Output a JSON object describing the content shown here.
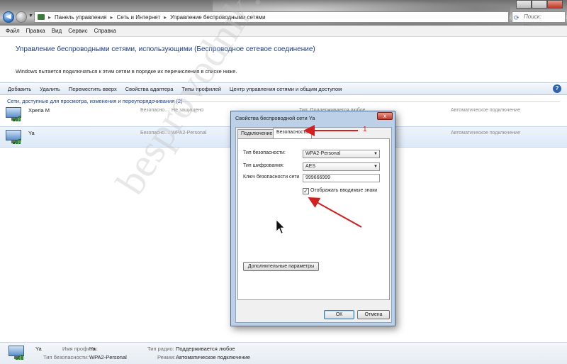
{
  "address_bar": {
    "crumbs": [
      "Панель управления",
      "Сеть и Интернет",
      "Управление беспроводными сетями"
    ],
    "search_placeholder": "Поиск: Управлен..."
  },
  "menu": [
    "Файл",
    "Правка",
    "Вид",
    "Сервис",
    "Справка"
  ],
  "header": {
    "title": "Управление беспроводными сетями, использующими (Беспроводное сетевое соединение)",
    "subtitle": "Windows пытается подключаться к этим сетям в порядке их перечисления в списке ниже."
  },
  "toolbar": [
    "Добавить",
    "Удалить",
    "Переместить вверх",
    "Свойства адаптера",
    "Типы профилей",
    "Центр управления сетями и общим доступом"
  ],
  "group_header": "Сети, доступные для просмотра, изменения и переупорядочивания (2)",
  "networks": [
    {
      "name": "Xperia M",
      "security": "Безопасно...: Не защищено",
      "radio": "Тип: Поддерживается любое",
      "mode": "Автоматическое подключение"
    },
    {
      "name": "Ya",
      "security": "Безопасно...: WPA2-Personal",
      "mode": "Автоматическое подключение"
    }
  ],
  "dialog": {
    "title": "Свойства беспроводной сети Ya",
    "close": "x",
    "tabs": [
      "Подключение",
      "Безопасность"
    ],
    "security_type_label": "Тип безопасности:",
    "security_type_value": "WPA2-Personal",
    "encryption_type_label": "Тип шифрования:",
    "encryption_type_value": "AES",
    "key_label": "Ключ безопасности сети",
    "key_value": "999666999",
    "show_chars_label": "Отображать вводимые знаки",
    "show_chars_checked": true,
    "advanced_button": "Дополнительные параметры",
    "ok_button": "ОК",
    "cancel_button": "Отмена"
  },
  "status_bar": {
    "profile_name_label": "Имя профиля:",
    "profile_name_value": "Ya",
    "security_type_label": "Тип безопасности:",
    "security_type_value": "WPA2-Personal",
    "radio_type_label": "Тип радио:",
    "radio_type_value": "Поддерживается любое",
    "mode_label": "Режим:",
    "mode_value": "Автоматическое подключение"
  },
  "annotation": {
    "number": "1",
    "watermark": "besprovodnik.ru",
    "color": "#d21f1f"
  }
}
